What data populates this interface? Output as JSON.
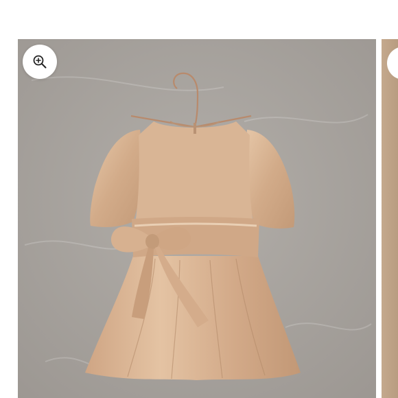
{
  "gallery": {
    "zoom_button": {
      "icon": "zoom-in-icon"
    },
    "slides": [
      {
        "subject": "product-photo",
        "active": true
      },
      {
        "subject": "product-photo",
        "active": false
      }
    ]
  },
  "colors": {
    "page_background": "#ffffff",
    "photo_backdrop": "#a9a49f",
    "dress": "#d6b08f",
    "hanger": "#b88a6c",
    "next_slide": "#c4a98d"
  }
}
